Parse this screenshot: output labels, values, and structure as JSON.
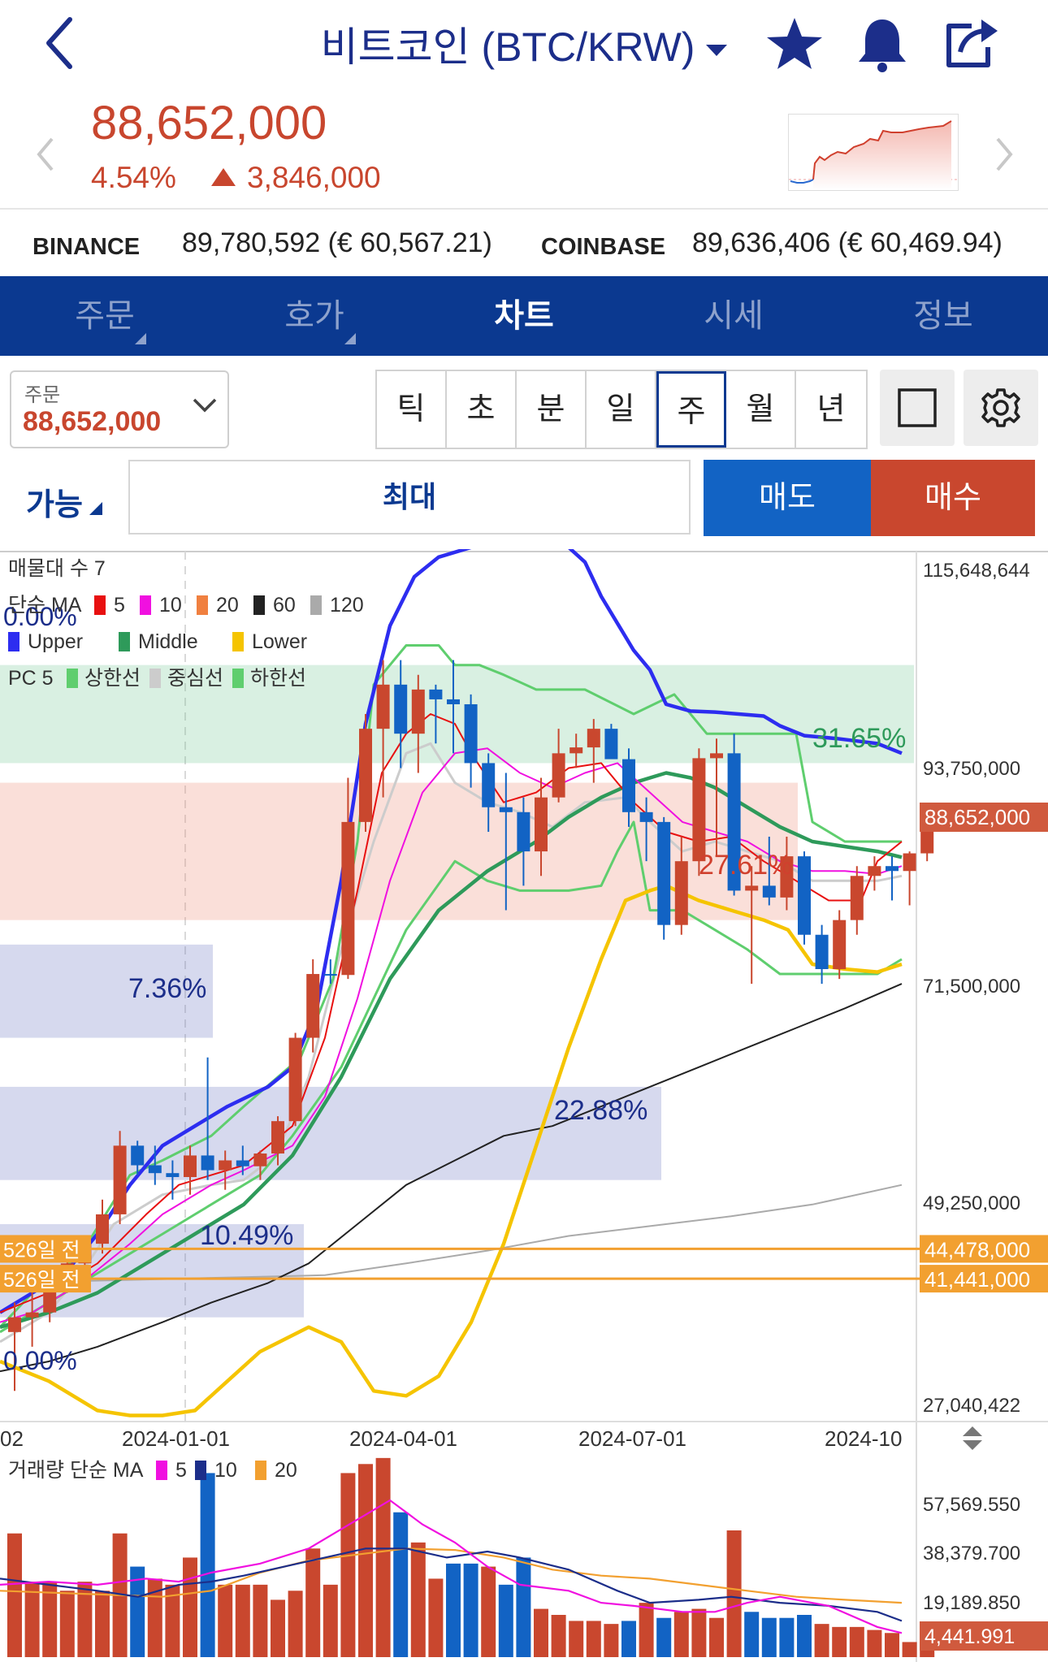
{
  "header": {
    "title": "비트코인 (BTC/KRW)",
    "icons": [
      "back-arrow-icon",
      "star-icon",
      "bell-icon",
      "share-icon"
    ]
  },
  "quote": {
    "price": "88,652,000",
    "change_pct": "4.54%",
    "change_amt": "3,846,000",
    "direction": "up"
  },
  "exchanges": [
    {
      "name": "BINANCE",
      "value": "89,780,592 (€ 60,567.21)"
    },
    {
      "name": "COINBASE",
      "value": "89,636,406 (€ 60,469.94)"
    }
  ],
  "tabs": [
    {
      "label": "주문",
      "active": false
    },
    {
      "label": "호가",
      "active": false
    },
    {
      "label": "차트",
      "active": true
    },
    {
      "label": "시세",
      "active": false
    },
    {
      "label": "정보",
      "active": false
    }
  ],
  "order": {
    "label": "주문",
    "value": "88,652,000"
  },
  "periods": [
    "틱",
    "초",
    "분",
    "일",
    "주",
    "월",
    "년"
  ],
  "selected_period": "주",
  "trade": {
    "available": "가능",
    "max": "최대",
    "sell": "매도",
    "buy": "매수"
  },
  "colors": {
    "brand": "#0b3990",
    "up": "#c8462e",
    "down": "#1263c4",
    "sell_button": "#1263c4",
    "buy_button": "#c9472e"
  },
  "chart_data": {
    "type": "candlestick",
    "title": "",
    "legends": {
      "volume_profile": "매물대 수 7",
      "ma_title": "단순 MA",
      "ma": [
        {
          "name": "5",
          "color": "#e81010"
        },
        {
          "name": "10",
          "color": "#f010e0"
        },
        {
          "name": "20",
          "color": "#f08040"
        },
        {
          "name": "60",
          "color": "#222222"
        },
        {
          "name": "120",
          "color": "#aaaaaa"
        }
      ],
      "bollinger": [
        {
          "name": "Upper",
          "color": "#2d2df0"
        },
        {
          "name": "Middle",
          "color": "#2e9a5a"
        },
        {
          "name": "Lower",
          "color": "#f5c400"
        }
      ],
      "pc_title": "PC 5",
      "pc": [
        {
          "name": "상한선",
          "color": "#5fce6e"
        },
        {
          "name": "중심선",
          "color": "#cccccc"
        },
        {
          "name": "하한선",
          "color": "#5fce6e"
        }
      ]
    },
    "y_ticks": [
      "115,648,644",
      "93,750,000",
      "71,500,000",
      "49,250,000",
      "27,040,422"
    ],
    "y_range": [
      27040422,
      115648644
    ],
    "x_ticks": [
      "02",
      "2024-01-01",
      "2024-04-01",
      "2024-07-01",
      "2024-10"
    ],
    "current_price_label": "88,652,000",
    "price_lines": [
      {
        "label": "44,478,000",
        "value": 44478000,
        "left_label": "526일 전"
      },
      {
        "label": "41,441,000",
        "value": 41441000,
        "left_label": "526일 전"
      }
    ],
    "volume_profile_labels": [
      "0.00%",
      "31.65%",
      "27.61%",
      "7.36%",
      "22.88%",
      "10.49%",
      "0.00%"
    ],
    "volume_legend": {
      "title": "거래량 단순 MA",
      "ma": [
        "5",
        "10",
        "20"
      ]
    },
    "volume_y_ticks": [
      "57,569.550",
      "38,379.700",
      "19,189.850"
    ],
    "volume_current_label": "4,441.991",
    "candles": [
      {
        "o": 36.0,
        "h": 39.0,
        "l": 30.0,
        "c": 37.5
      },
      {
        "o": 37.5,
        "h": 40.5,
        "l": 34.5,
        "c": 38.0
      },
      {
        "o": 38.0,
        "h": 42.0,
        "l": 37.0,
        "c": 41.5
      },
      {
        "o": 41.5,
        "h": 44.0,
        "l": 40.0,
        "c": 43.0
      },
      {
        "o": 43.0,
        "h": 45.5,
        "l": 42.0,
        "c": 45.0
      },
      {
        "o": 45.0,
        "h": 49.5,
        "l": 44.0,
        "c": 48.0
      },
      {
        "o": 48.0,
        "h": 56.5,
        "l": 47.0,
        "c": 55.0
      },
      {
        "o": 55.0,
        "h": 55.5,
        "l": 52.0,
        "c": 53.0
      },
      {
        "o": 53.0,
        "h": 55.0,
        "l": 51.0,
        "c": 52.2
      },
      {
        "o": 52.2,
        "h": 53.5,
        "l": 49.5,
        "c": 51.8
      },
      {
        "o": 51.8,
        "h": 55.0,
        "l": 50.0,
        "c": 54.0
      },
      {
        "o": 54.0,
        "h": 64.0,
        "l": 51.5,
        "c": 52.5
      },
      {
        "o": 52.5,
        "h": 54.5,
        "l": 50.5,
        "c": 53.5
      },
      {
        "o": 53.5,
        "h": 55.0,
        "l": 52.0,
        "c": 52.9
      },
      {
        "o": 52.9,
        "h": 54.5,
        "l": 51.5,
        "c": 54.2
      },
      {
        "o": 54.2,
        "h": 58.0,
        "l": 53.0,
        "c": 57.5
      },
      {
        "o": 57.5,
        "h": 66.5,
        "l": 57.0,
        "c": 66.0
      },
      {
        "o": 66.0,
        "h": 74.0,
        "l": 64.5,
        "c": 72.5
      },
      {
        "o": 72.5,
        "h": 74.0,
        "l": 71.5,
        "c": 72.4
      },
      {
        "o": 72.4,
        "h": 92.5,
        "l": 72.0,
        "c": 88.0
      },
      {
        "o": 88.0,
        "h": 99.0,
        "l": 87.0,
        "c": 97.5
      },
      {
        "o": 97.5,
        "h": 104.5,
        "l": 90.5,
        "c": 102.0
      },
      {
        "o": 102.0,
        "h": 104.5,
        "l": 93.5,
        "c": 97.0
      },
      {
        "o": 97.0,
        "h": 103.0,
        "l": 93.0,
        "c": 101.5
      },
      {
        "o": 101.5,
        "h": 102.0,
        "l": 96.0,
        "c": 100.5
      },
      {
        "o": 100.5,
        "h": 104.5,
        "l": 95.0,
        "c": 100.0
      },
      {
        "o": 100.0,
        "h": 101.0,
        "l": 91.5,
        "c": 94.0
      },
      {
        "o": 94.0,
        "h": 95.0,
        "l": 87.0,
        "c": 89.5
      },
      {
        "o": 89.5,
        "h": 93.0,
        "l": 79.0,
        "c": 89.0
      },
      {
        "o": 89.0,
        "h": 90.5,
        "l": 81.5,
        "c": 85.0
      },
      {
        "o": 85.0,
        "h": 92.5,
        "l": 82.5,
        "c": 90.5
      },
      {
        "o": 90.5,
        "h": 97.5,
        "l": 90.0,
        "c": 95.0
      },
      {
        "o": 95.0,
        "h": 97.0,
        "l": 93.5,
        "c": 95.6
      },
      {
        "o": 95.6,
        "h": 98.5,
        "l": 92.0,
        "c": 97.5
      },
      {
        "o": 97.5,
        "h": 98.0,
        "l": 94.5,
        "c": 94.4
      },
      {
        "o": 94.4,
        "h": 95.5,
        "l": 87.5,
        "c": 89.0
      },
      {
        "o": 89.0,
        "h": 90.5,
        "l": 84.0,
        "c": 88.0
      },
      {
        "o": 88.0,
        "h": 88.5,
        "l": 76.0,
        "c": 77.5
      },
      {
        "o": 77.5,
        "h": 86.5,
        "l": 76.5,
        "c": 84.0
      },
      {
        "o": 84.0,
        "h": 95.5,
        "l": 82.5,
        "c": 94.5
      },
      {
        "o": 94.5,
        "h": 96.5,
        "l": 84.5,
        "c": 95.0
      },
      {
        "o": 95.0,
        "h": 97.0,
        "l": 80.5,
        "c": 81.0
      },
      {
        "o": 81.0,
        "h": 83.5,
        "l": 71.5,
        "c": 81.5
      },
      {
        "o": 81.5,
        "h": 86.5,
        "l": 79.5,
        "c": 80.3
      },
      {
        "o": 80.3,
        "h": 86.5,
        "l": 79.0,
        "c": 84.5
      },
      {
        "o": 84.5,
        "h": 85.0,
        "l": 75.5,
        "c": 76.5
      },
      {
        "o": 76.5,
        "h": 77.5,
        "l": 71.5,
        "c": 73.0
      },
      {
        "o": 73.0,
        "h": 79.0,
        "l": 72.0,
        "c": 78.0
      },
      {
        "o": 78.0,
        "h": 83.5,
        "l": 76.5,
        "c": 82.5
      },
      {
        "o": 82.5,
        "h": 84.5,
        "l": 81.0,
        "c": 83.5
      },
      {
        "o": 83.5,
        "h": 84.5,
        "l": 80.0,
        "c": 83.0
      },
      {
        "o": 83.0,
        "h": 85.0,
        "l": 79.5,
        "c": 84.8
      },
      {
        "o": 84.8,
        "h": 89.0,
        "l": 84.0,
        "c": 88.65
      }
    ],
    "volume": [
      {
        "v": 41,
        "up": true
      },
      {
        "v": 25,
        "up": true
      },
      {
        "v": 25,
        "up": true
      },
      {
        "v": 22,
        "up": true
      },
      {
        "v": 25,
        "up": true
      },
      {
        "v": 22,
        "up": true
      },
      {
        "v": 41,
        "up": true
      },
      {
        "v": 30,
        "up": false
      },
      {
        "v": 26,
        "up": true
      },
      {
        "v": 24,
        "up": true
      },
      {
        "v": 33,
        "up": true
      },
      {
        "v": 61,
        "up": false
      },
      {
        "v": 24,
        "up": true
      },
      {
        "v": 24,
        "up": true
      },
      {
        "v": 24,
        "up": true
      },
      {
        "v": 19,
        "up": true
      },
      {
        "v": 22,
        "up": true
      },
      {
        "v": 36,
        "up": true
      },
      {
        "v": 24,
        "up": true
      },
      {
        "v": 61,
        "up": true
      },
      {
        "v": 64,
        "up": true
      },
      {
        "v": 66,
        "up": true
      },
      {
        "v": 48,
        "up": false
      },
      {
        "v": 38,
        "up": true
      },
      {
        "v": 26,
        "up": true
      },
      {
        "v": 31,
        "up": false
      },
      {
        "v": 31,
        "up": false
      },
      {
        "v": 30,
        "up": true
      },
      {
        "v": 24,
        "up": false
      },
      {
        "v": 33,
        "up": false
      },
      {
        "v": 16,
        "up": true
      },
      {
        "v": 14,
        "up": true
      },
      {
        "v": 12,
        "up": true
      },
      {
        "v": 12,
        "up": true
      },
      {
        "v": 11,
        "up": true
      },
      {
        "v": 12,
        "up": false
      },
      {
        "v": 18,
        "up": true
      },
      {
        "v": 13,
        "up": false
      },
      {
        "v": 15,
        "up": true
      },
      {
        "v": 16,
        "up": true
      },
      {
        "v": 13,
        "up": true
      },
      {
        "v": 42,
        "up": true
      },
      {
        "v": 15,
        "up": false
      },
      {
        "v": 13,
        "up": false
      },
      {
        "v": 13,
        "up": false
      },
      {
        "v": 14,
        "up": false
      },
      {
        "v": 11,
        "up": true
      },
      {
        "v": 10,
        "up": true
      },
      {
        "v": 10,
        "up": true
      },
      {
        "v": 9,
        "up": true
      },
      {
        "v": 8,
        "up": true
      },
      {
        "v": 5,
        "up": true
      },
      {
        "v": 4,
        "up": true
      }
    ]
  }
}
